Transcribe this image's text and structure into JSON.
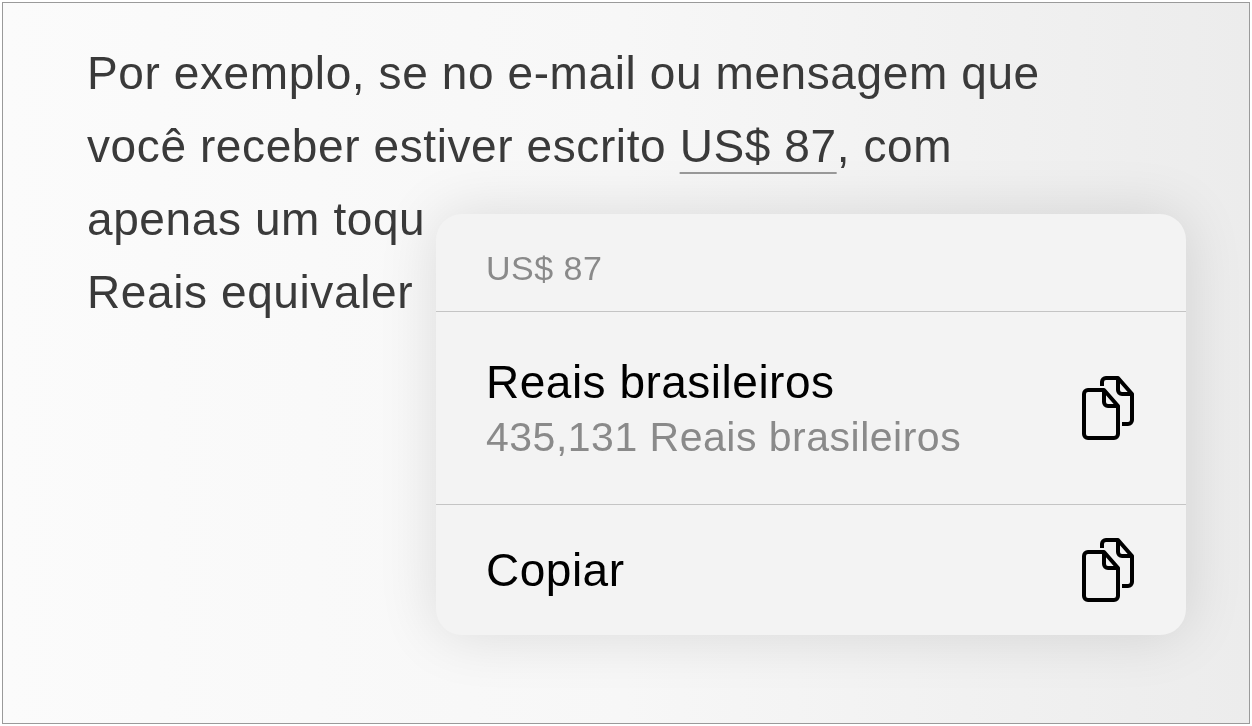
{
  "paragraph": {
    "lines": [
      [
        {
          "text": "Por exemplo, se no e-mail ou mensagem que",
          "kind": "text"
        }
      ],
      [
        {
          "text": "você receber estiver escrito ",
          "kind": "text"
        },
        {
          "text": "US$ 87",
          "kind": "link"
        },
        {
          "text": ", com",
          "kind": "text"
        }
      ],
      [
        {
          "text": "apenas um toqu",
          "kind": "text"
        }
      ],
      [
        {
          "text": "Reais equivaler",
          "kind": "text"
        }
      ]
    ]
  },
  "menu": {
    "header": "US$ 87",
    "items": [
      {
        "title": "Reais brasileiros",
        "subtitle": "435,131 Reais brasileiros"
      },
      {
        "title": "Copiar"
      }
    ]
  }
}
